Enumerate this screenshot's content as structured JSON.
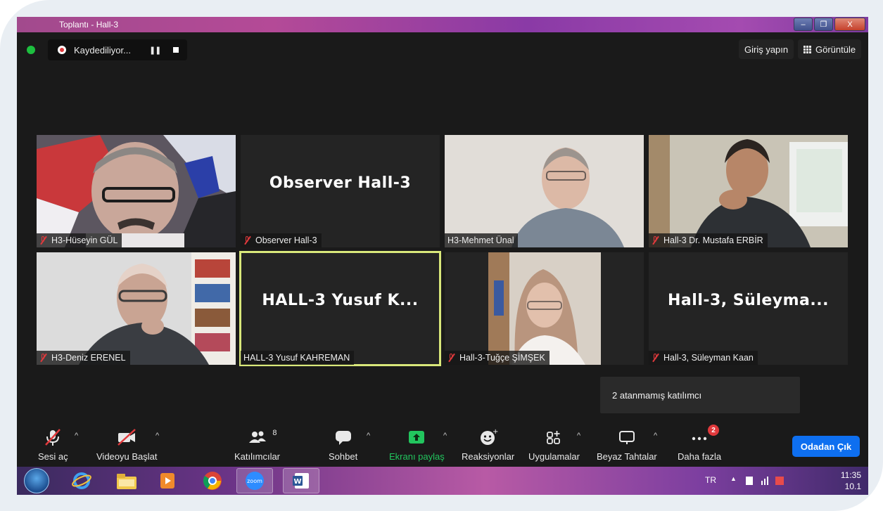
{
  "window": {
    "title": "Toplantı - Hall-3",
    "minimize": "–",
    "maximize": "❐",
    "close": "X"
  },
  "recording": {
    "label": "Kaydediliyor...",
    "pause": "❚❚"
  },
  "header": {
    "signin": "Giriş yapın",
    "view": "Görüntüle"
  },
  "tiles": [
    {
      "big": "",
      "tag": "H3-Hüseyin GÜL",
      "muted": true
    },
    {
      "big": "Observer Hall-3",
      "tag": "Observer Hall-3",
      "muted": true
    },
    {
      "big": "",
      "tag": "H3-Mehmet Ünal",
      "muted": false
    },
    {
      "big": "",
      "tag": "Hall-3 Dr. Mustafa ERBİR",
      "muted": true
    },
    {
      "big": "",
      "tag": "H3-Deniz ERENEL",
      "muted": true
    },
    {
      "big": "HALL-3  Yusuf  K...",
      "tag": "HALL-3 Yusuf KAHREMAN",
      "muted": false
    },
    {
      "big": "",
      "tag": "Hall-3-Tuğçe ŞİMŞEK",
      "muted": true
    },
    {
      "big": "Hall-3,  Süleyma...",
      "tag": "Hall-3, Süleyman Kaan",
      "muted": true
    }
  ],
  "tooltip": "2 atanmamış katılımcı",
  "toolbar": {
    "audio": "Sesi aç",
    "video": "Videoyu Başlat",
    "participants": "Katılımcılar",
    "participants_count": "8",
    "chat": "Sohbet",
    "share": "Ekranı paylaş",
    "reactions": "Reaksiyonlar",
    "apps": "Uygulamalar",
    "whiteboard": "Beyaz Tahtalar",
    "more": "Daha fazla",
    "more_badge": "2",
    "leave": "Odadan Çık",
    "caret": "^"
  },
  "taskbar": {
    "lang": "TR",
    "time": "11:35",
    "date": "10.1",
    "zoom_label": "zoom"
  },
  "colors": {
    "share_green": "#22c55e",
    "leave_blue": "#0e6ff0",
    "active_speaker": "#d9e87a",
    "mute_red": "#e0393c"
  }
}
